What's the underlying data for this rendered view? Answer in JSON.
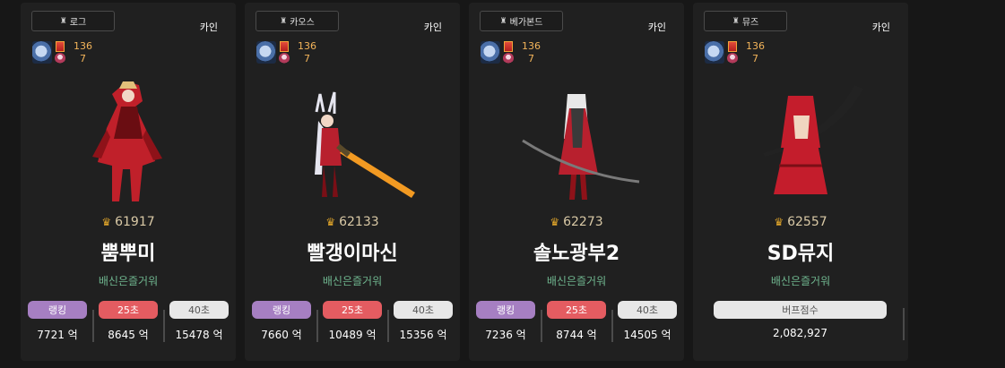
{
  "cards": [
    {
      "job": "로그",
      "server": "카인",
      "level": "136",
      "level_sub": "7",
      "fame": "61917",
      "name": "뿜뿌미",
      "guild": "배신은즐거워",
      "stats": [
        {
          "label": "랭킹",
          "value": "7721 억",
          "color": "purple"
        },
        {
          "label": "25초",
          "value": "8645 억",
          "color": "red"
        },
        {
          "label": "40초",
          "value": "15478 억",
          "color": "gray"
        }
      ],
      "art_colors": [
        "#c0202a",
        "#6a0d12",
        "#e2c07a"
      ]
    },
    {
      "job": "카오스",
      "server": "카인",
      "level": "136",
      "level_sub": "7",
      "fame": "62133",
      "name": "빨갱이마신",
      "guild": "배신은즐거워",
      "stats": [
        {
          "label": "랭킹",
          "value": "7660 억",
          "color": "purple"
        },
        {
          "label": "25초",
          "value": "10489 억",
          "color": "red"
        },
        {
          "label": "40초",
          "value": "15356 억",
          "color": "gray"
        }
      ],
      "art_colors": [
        "#b8202e",
        "#e6e6f0",
        "#f29a22"
      ]
    },
    {
      "job": "베가본드",
      "server": "카인",
      "level": "136",
      "level_sub": "7",
      "fame": "62273",
      "name": "솔노광부2",
      "guild": "배신은즐거워",
      "stats": [
        {
          "label": "랭킹",
          "value": "7236 억",
          "color": "purple"
        },
        {
          "label": "25초",
          "value": "8744 억",
          "color": "red"
        },
        {
          "label": "40초",
          "value": "14505 억",
          "color": "gray"
        }
      ],
      "art_colors": [
        "#b8202e",
        "#e8e8e8",
        "#3a3a3a"
      ]
    },
    {
      "job": "뮤즈",
      "server": "카인",
      "level": "136",
      "level_sub": "7",
      "fame": "62557",
      "name": "SD뮤지",
      "guild": "배신은즐거워",
      "buff": {
        "label": "버프점수",
        "value": "2,082,927"
      },
      "art_colors": [
        "#c41d2c",
        "#f0d6c0",
        "#222222"
      ]
    }
  ]
}
